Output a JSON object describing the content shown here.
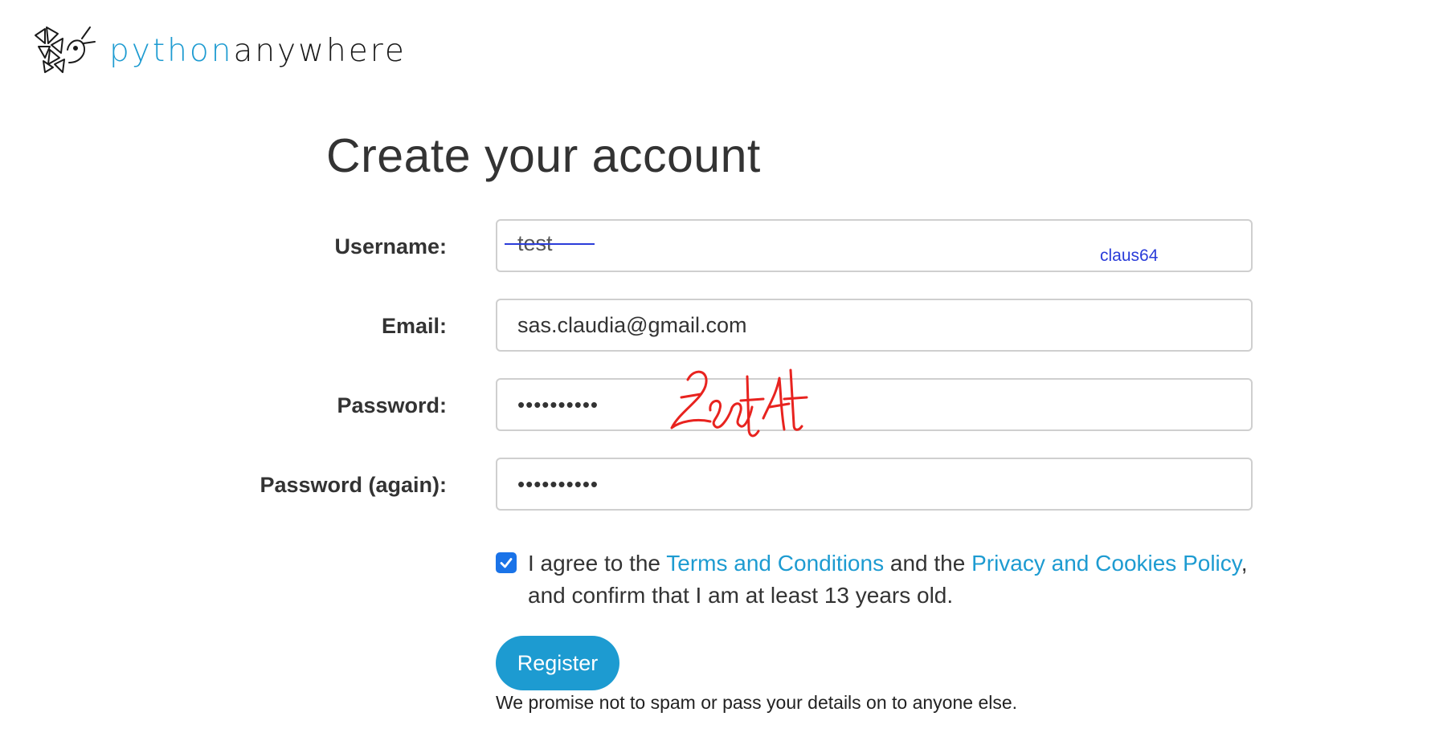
{
  "brand": {
    "name_part1": "python",
    "name_part2": "anywhere",
    "color_python": "#1d9bd1",
    "color_anywhere": "#1a1a1a"
  },
  "title": "Create your account",
  "fields": {
    "username": {
      "label": "Username:",
      "value": "test",
      "handwritten_replacement": "claus64"
    },
    "email": {
      "label": "Email:",
      "value": "sas.claudia@gmail.com"
    },
    "password": {
      "label": "Password:",
      "value": "••••••••••"
    },
    "password_again": {
      "label": "Password (again):",
      "value": "••••••••••"
    }
  },
  "signature": {
    "text": "Zsetst",
    "color": "#e8231f"
  },
  "agree": {
    "checked": true,
    "text_1": "I agree to the ",
    "terms_link": "Terms and Conditions",
    "text_2": " and the ",
    "privacy_link": "Privacy and Cookies Policy",
    "text_3": ", and confirm that I am at least 13 years old."
  },
  "register_button": "Register",
  "promise": "We promise not to spam or pass your details on to anyone else.",
  "colors": {
    "accent": "#1d9bd1",
    "checkbox": "#1a73e8",
    "annotation_blue": "#2a3cd9"
  }
}
